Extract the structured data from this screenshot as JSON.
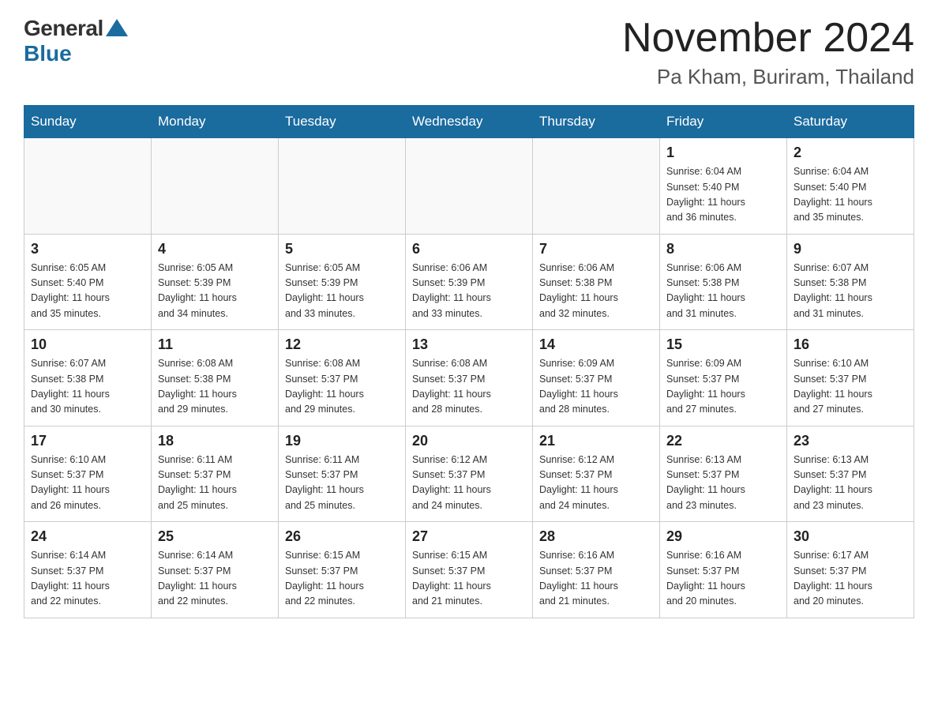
{
  "header": {
    "logo_general": "General",
    "logo_blue": "Blue",
    "month_title": "November 2024",
    "location": "Pa Kham, Buriram, Thailand"
  },
  "weekdays": [
    "Sunday",
    "Monday",
    "Tuesday",
    "Wednesday",
    "Thursday",
    "Friday",
    "Saturday"
  ],
  "weeks": [
    [
      {
        "day": "",
        "info": ""
      },
      {
        "day": "",
        "info": ""
      },
      {
        "day": "",
        "info": ""
      },
      {
        "day": "",
        "info": ""
      },
      {
        "day": "",
        "info": ""
      },
      {
        "day": "1",
        "info": "Sunrise: 6:04 AM\nSunset: 5:40 PM\nDaylight: 11 hours\nand 36 minutes."
      },
      {
        "day": "2",
        "info": "Sunrise: 6:04 AM\nSunset: 5:40 PM\nDaylight: 11 hours\nand 35 minutes."
      }
    ],
    [
      {
        "day": "3",
        "info": "Sunrise: 6:05 AM\nSunset: 5:40 PM\nDaylight: 11 hours\nand 35 minutes."
      },
      {
        "day": "4",
        "info": "Sunrise: 6:05 AM\nSunset: 5:39 PM\nDaylight: 11 hours\nand 34 minutes."
      },
      {
        "day": "5",
        "info": "Sunrise: 6:05 AM\nSunset: 5:39 PM\nDaylight: 11 hours\nand 33 minutes."
      },
      {
        "day": "6",
        "info": "Sunrise: 6:06 AM\nSunset: 5:39 PM\nDaylight: 11 hours\nand 33 minutes."
      },
      {
        "day": "7",
        "info": "Sunrise: 6:06 AM\nSunset: 5:38 PM\nDaylight: 11 hours\nand 32 minutes."
      },
      {
        "day": "8",
        "info": "Sunrise: 6:06 AM\nSunset: 5:38 PM\nDaylight: 11 hours\nand 31 minutes."
      },
      {
        "day": "9",
        "info": "Sunrise: 6:07 AM\nSunset: 5:38 PM\nDaylight: 11 hours\nand 31 minutes."
      }
    ],
    [
      {
        "day": "10",
        "info": "Sunrise: 6:07 AM\nSunset: 5:38 PM\nDaylight: 11 hours\nand 30 minutes."
      },
      {
        "day": "11",
        "info": "Sunrise: 6:08 AM\nSunset: 5:38 PM\nDaylight: 11 hours\nand 29 minutes."
      },
      {
        "day": "12",
        "info": "Sunrise: 6:08 AM\nSunset: 5:37 PM\nDaylight: 11 hours\nand 29 minutes."
      },
      {
        "day": "13",
        "info": "Sunrise: 6:08 AM\nSunset: 5:37 PM\nDaylight: 11 hours\nand 28 minutes."
      },
      {
        "day": "14",
        "info": "Sunrise: 6:09 AM\nSunset: 5:37 PM\nDaylight: 11 hours\nand 28 minutes."
      },
      {
        "day": "15",
        "info": "Sunrise: 6:09 AM\nSunset: 5:37 PM\nDaylight: 11 hours\nand 27 minutes."
      },
      {
        "day": "16",
        "info": "Sunrise: 6:10 AM\nSunset: 5:37 PM\nDaylight: 11 hours\nand 27 minutes."
      }
    ],
    [
      {
        "day": "17",
        "info": "Sunrise: 6:10 AM\nSunset: 5:37 PM\nDaylight: 11 hours\nand 26 minutes."
      },
      {
        "day": "18",
        "info": "Sunrise: 6:11 AM\nSunset: 5:37 PM\nDaylight: 11 hours\nand 25 minutes."
      },
      {
        "day": "19",
        "info": "Sunrise: 6:11 AM\nSunset: 5:37 PM\nDaylight: 11 hours\nand 25 minutes."
      },
      {
        "day": "20",
        "info": "Sunrise: 6:12 AM\nSunset: 5:37 PM\nDaylight: 11 hours\nand 24 minutes."
      },
      {
        "day": "21",
        "info": "Sunrise: 6:12 AM\nSunset: 5:37 PM\nDaylight: 11 hours\nand 24 minutes."
      },
      {
        "day": "22",
        "info": "Sunrise: 6:13 AM\nSunset: 5:37 PM\nDaylight: 11 hours\nand 23 minutes."
      },
      {
        "day": "23",
        "info": "Sunrise: 6:13 AM\nSunset: 5:37 PM\nDaylight: 11 hours\nand 23 minutes."
      }
    ],
    [
      {
        "day": "24",
        "info": "Sunrise: 6:14 AM\nSunset: 5:37 PM\nDaylight: 11 hours\nand 22 minutes."
      },
      {
        "day": "25",
        "info": "Sunrise: 6:14 AM\nSunset: 5:37 PM\nDaylight: 11 hours\nand 22 minutes."
      },
      {
        "day": "26",
        "info": "Sunrise: 6:15 AM\nSunset: 5:37 PM\nDaylight: 11 hours\nand 22 minutes."
      },
      {
        "day": "27",
        "info": "Sunrise: 6:15 AM\nSunset: 5:37 PM\nDaylight: 11 hours\nand 21 minutes."
      },
      {
        "day": "28",
        "info": "Sunrise: 6:16 AM\nSunset: 5:37 PM\nDaylight: 11 hours\nand 21 minutes."
      },
      {
        "day": "29",
        "info": "Sunrise: 6:16 AM\nSunset: 5:37 PM\nDaylight: 11 hours\nand 20 minutes."
      },
      {
        "day": "30",
        "info": "Sunrise: 6:17 AM\nSunset: 5:37 PM\nDaylight: 11 hours\nand 20 minutes."
      }
    ]
  ]
}
